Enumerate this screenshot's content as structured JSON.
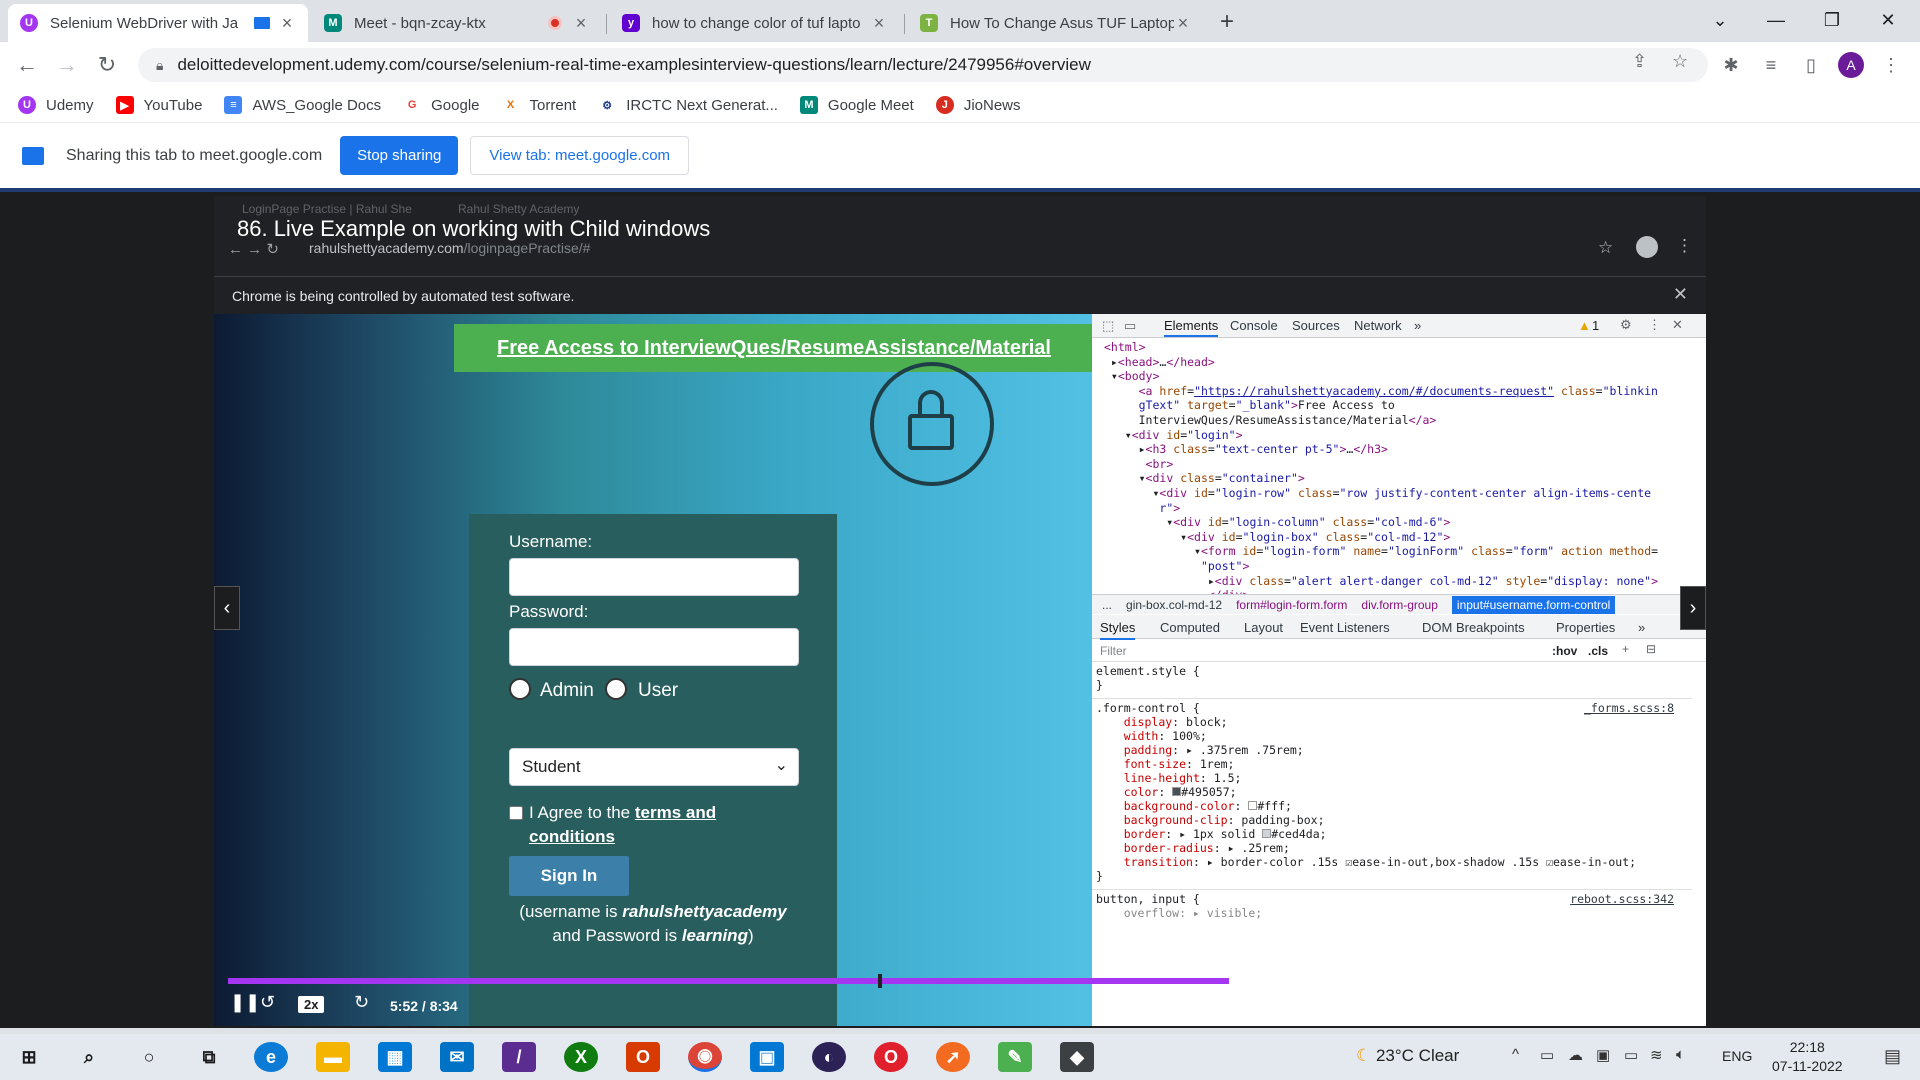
{
  "browser": {
    "tabs": [
      {
        "title": "Selenium WebDriver with Ja",
        "active": true,
        "favicon": "udemy-icon",
        "color": "#a435f0"
      },
      {
        "title": "Meet - bqn-zcay-ktx",
        "active": false,
        "favicon": "google-meet-icon",
        "color": "#00897b"
      },
      {
        "title": "how to change color of tuf lapto",
        "active": false,
        "favicon": "yahoo-icon",
        "color": "#6001d2"
      },
      {
        "title": "How To Change Asus TUF Laptop",
        "active": false,
        "favicon": "tdg-icon",
        "color": "#7cb342"
      }
    ],
    "url": "deloittedevelopment.udemy.com/course/selenium-real-time-examplesinterview-questions/learn/lecture/2479956#overview",
    "profile_initial": "A"
  },
  "bookmarks": [
    {
      "label": "Udemy",
      "color": "#a435f0",
      "glyph": "U"
    },
    {
      "label": "YouTube",
      "color": "#ff0000",
      "glyph": "▶"
    },
    {
      "label": "AWS_Google Docs",
      "color": "#4285f4",
      "glyph": "≡"
    },
    {
      "label": "Google",
      "color": "#ea4335",
      "glyph": "G"
    },
    {
      "label": "Torrent",
      "color": "#e8710a",
      "glyph": "X"
    },
    {
      "label": "IRCTC Next Generat...",
      "color": "#1a3d8f",
      "glyph": "I"
    },
    {
      "label": "Google Meet",
      "color": "#00897b",
      "glyph": "M"
    },
    {
      "label": "JioNews",
      "color": "#d62d20",
      "glyph": "J"
    }
  ],
  "sharing": {
    "message": "Sharing this tab to meet.google.com",
    "stop_label": "Stop sharing",
    "view_label": "View tab: meet.google.com"
  },
  "video": {
    "title": "86. Live Example on working with Child windows",
    "inner_tab1": "LoginPage Practise | Rahul She",
    "inner_tab2": "Rahul Shetty Academy",
    "inner_url_host": "rahulshettyacademy.com",
    "inner_url_path": "/loginpagePractise/#",
    "automation_message": "Chrome is being controlled by automated test software.",
    "speed": "2x",
    "timecode": "5:52 / 8:34",
    "progress": 0.684
  },
  "login_page": {
    "promo_link": "Free Access to InterviewQues/ResumeAssistance/Material",
    "username_label": "Username:",
    "password_label": "Password:",
    "radio_admin": "Admin",
    "radio_user": "User",
    "select_value": "Student",
    "terms_prefix": "I Agree to the",
    "terms_link": "terms and conditions",
    "signin_label": "Sign In",
    "hint_prefix": "(username is",
    "hint_user": "rahulshettyacademy",
    "hint_mid": "and Password is",
    "hint_pass": "learning",
    "hint_suffix": ")"
  },
  "devtools": {
    "tabs": [
      "Elements",
      "Console",
      "Sources",
      "Network",
      "»"
    ],
    "warning_count": "1",
    "breadcrumbs": [
      "...",
      "gin-box.col-md-12",
      "form#login-form.form",
      "div.form-group",
      "input#username.form-control"
    ],
    "panel_tabs": [
      "Styles",
      "Computed",
      "Layout",
      "Event Listeners",
      "DOM Breakpoints",
      "Properties",
      "»"
    ],
    "filter_placeholder": "Filter",
    "filter_hov": ":hov",
    "filter_cls": ".cls",
    "source_forms": "_forms.scss:8",
    "source_reboot": "reboot.scss:342"
  },
  "taskbar": {
    "weather": "23°C  Clear",
    "lang": "ENG",
    "time": "22:18",
    "date": "07-11-2022"
  }
}
